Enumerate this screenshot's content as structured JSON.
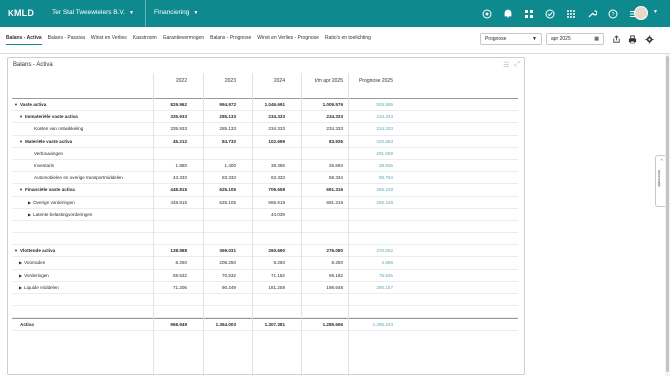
{
  "topbar": {
    "logo": "MLD",
    "logo_prefix": "K",
    "company": "Ter Stal Tweewielers B.V.",
    "module": "Financiering",
    "icons": [
      "target-icon",
      "bell-icon",
      "grid-icon",
      "check-circle-icon",
      "apps-icon",
      "wrench-icon",
      "help-icon",
      "menu-icon"
    ],
    "accent": "#0e8a8e"
  },
  "tabs": [
    {
      "label": "Balans - Activa",
      "active": true
    },
    {
      "label": "Balans - Passiva"
    },
    {
      "label": "Winst en Verlies"
    },
    {
      "label": "Kasstroom"
    },
    {
      "label": "Garantievermogen"
    },
    {
      "label": "Balans - Prognose"
    },
    {
      "label": "Winst en Verlies - Prognose"
    },
    {
      "label": "Ratio's en toelichting"
    }
  ],
  "filters": {
    "scenario": "Prognose",
    "month": "apr 2025"
  },
  "panel": {
    "title": "Balans - Activa",
    "columns": [
      "2022",
      "2023",
      "2024",
      "t/m apr 2025",
      "Prognose 2025"
    ]
  },
  "rows": [
    {
      "label": "Vaste activa",
      "level": 0,
      "caret": "down",
      "bold": true,
      "v": [
        "829.962",
        "994.972",
        "1.046.691",
        "1.009.576",
        "925.595"
      ]
    },
    {
      "label": "Immateriële vaste activa",
      "level": 1,
      "caret": "down",
      "bold": true,
      "v": [
        "335.933",
        "285.133",
        "234.333",
        "234.333",
        "234.333"
      ]
    },
    {
      "label": "Kosten van ontwikkeling",
      "level": 2,
      "v": [
        "335.933",
        "285.133",
        "234.333",
        "234.333",
        "234.333"
      ]
    },
    {
      "label": "Materiële vaste activa",
      "level": 1,
      "caret": "down",
      "bold": true,
      "v": [
        "45.213",
        "84.733",
        "102.699",
        "83.926",
        "420.653"
      ]
    },
    {
      "label": "Verbouwingen",
      "level": 2,
      "v": [
        "",
        "",
        "",
        "",
        "291.069"
      ]
    },
    {
      "label": "Inventaris",
      "level": 2,
      "v": [
        "1.880",
        "1.400",
        "39.366",
        "25.593",
        "38.846"
      ]
    },
    {
      "label": "Automobielen en overige transportmiddelen",
      "level": 2,
      "v": [
        "43.333",
        "83.333",
        "63.333",
        "58.334",
        "90.764"
      ]
    },
    {
      "label": "Financiële vaste activa",
      "level": 1,
      "caret": "down",
      "bold": true,
      "v": [
        "448.815",
        "625.105",
        "709.658",
        "691.316",
        "266.248"
      ]
    },
    {
      "label": "Overige vorderingen",
      "level": 2,
      "caret": "right",
      "v": [
        "448.815",
        "625.105",
        "665.619",
        "691.316",
        "266.248"
      ]
    },
    {
      "label": "Latente belastingvorderingen",
      "level": 2,
      "caret": "right",
      "v": [
        "",
        "",
        "44.039",
        "",
        ""
      ]
    },
    {
      "spacer": true
    },
    {
      "spacer": true
    },
    {
      "label": "Vlottende activa",
      "level": 0,
      "caret": "down",
      "bold": true,
      "v": [
        "138.988",
        "369.031",
        "260.690",
        "276.080",
        "470.052"
      ]
    },
    {
      "label": "Voorraden",
      "level": 1,
      "caret": "right",
      "v": [
        "8.250",
        "208.250",
        "8.250",
        "8.250",
        "4.896"
      ]
    },
    {
      "label": "Vorderingen",
      "level": 1,
      "caret": "right",
      "v": [
        "59.532",
        "70.532",
        "71.182",
        "69.182",
        "75.645"
      ]
    },
    {
      "label": "Liquide middelen",
      "level": 1,
      "caret": "right",
      "v": [
        "71.206",
        "90.249",
        "181.258",
        "198.648",
        "390.157"
      ]
    },
    {
      "spacer": true
    },
    {
      "spacer": true
    }
  ],
  "total": {
    "label": "Activa",
    "v": [
      "968.949",
      "1.364.003",
      "1.307.381",
      "1.285.656",
      "1.395.243"
    ]
  },
  "side_tab": "Informatie"
}
